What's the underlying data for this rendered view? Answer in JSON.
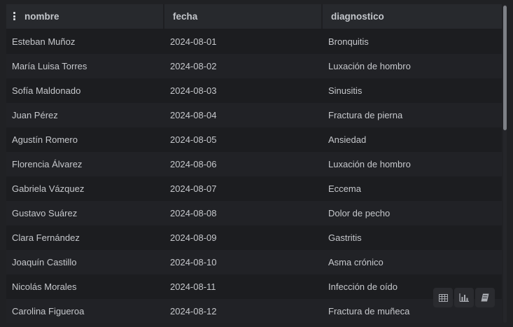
{
  "columns": {
    "nombre": "nombre",
    "fecha": "fecha",
    "diagnostico": "diagnostico"
  },
  "rows": [
    {
      "nombre": "Esteban Muñoz",
      "fecha": "2024-08-01",
      "diagnostico": "Bronquitis"
    },
    {
      "nombre": "María Luisa Torres",
      "fecha": "2024-08-02",
      "diagnostico": "Luxación de hombro"
    },
    {
      "nombre": "Sofía Maldonado",
      "fecha": "2024-08-03",
      "diagnostico": "Sinusitis"
    },
    {
      "nombre": "Juan Pérez",
      "fecha": "2024-08-04",
      "diagnostico": "Fractura de pierna"
    },
    {
      "nombre": "Agustín Romero",
      "fecha": "2024-08-05",
      "diagnostico": "Ansiedad"
    },
    {
      "nombre": "Florencia Álvarez",
      "fecha": "2024-08-06",
      "diagnostico": "Luxación de hombro"
    },
    {
      "nombre": "Gabriela Vázquez",
      "fecha": "2024-08-07",
      "diagnostico": "Eccema"
    },
    {
      "nombre": "Gustavo Suárez",
      "fecha": "2024-08-08",
      "diagnostico": "Dolor de pecho"
    },
    {
      "nombre": "Clara Fernández",
      "fecha": "2024-08-09",
      "diagnostico": "Gastritis"
    },
    {
      "nombre": "Joaquín Castillo",
      "fecha": "2024-08-10",
      "diagnostico": "Asma crónico"
    },
    {
      "nombre": "Nicolás Morales",
      "fecha": "2024-08-11",
      "diagnostico": "Infección de oído"
    },
    {
      "nombre": "Carolina Figueroa",
      "fecha": "2024-08-12",
      "diagnostico": "Fractura de muñeca"
    }
  ],
  "view_switcher": {
    "icons": [
      "table-icon",
      "bar-chart-icon",
      "notebook-icon"
    ]
  },
  "colors": {
    "background": "#202124",
    "header_background": "#27292d",
    "row_odd": "#1c1d20",
    "row_even": "#212226",
    "text": "#c6c8cc",
    "scroll_thumb": "#7d8086"
  }
}
